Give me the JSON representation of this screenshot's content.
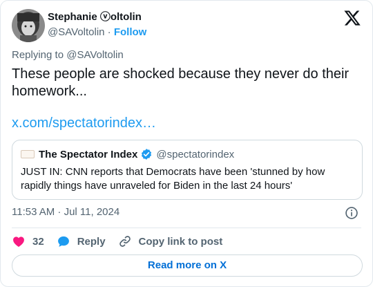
{
  "author": {
    "name": "Stephanie ⓥoltolin",
    "handle": "@SAVoltolin",
    "separator": "·",
    "follow_label": "Follow"
  },
  "replying_to": "Replying to @SAVoltolin",
  "tweet": {
    "text": "These people are shocked because they never do their homework...",
    "link": "x.com/spectatorindex…"
  },
  "quote": {
    "name": "The Spectator Index",
    "handle": "@spectatorindex",
    "text": "JUST IN: CNN reports that Democrats have been 'stunned by how rapidly things have unraveled for Biden in the last 24 hours'"
  },
  "timestamp": "11:53 AM · Jul 11, 2024",
  "actions": {
    "like_count": "32",
    "reply_label": "Reply",
    "copy_label": "Copy link to post"
  },
  "read_more_label": "Read more on X",
  "colors": {
    "accent": "#1d9bf0",
    "like": "#f91880",
    "verified": "#1d9bf0",
    "read_more": "#006fd6"
  },
  "icons": [
    "avatar",
    "x-logo-icon",
    "verified-badge-icon",
    "info-icon",
    "heart-icon",
    "reply-icon",
    "link-icon"
  ]
}
